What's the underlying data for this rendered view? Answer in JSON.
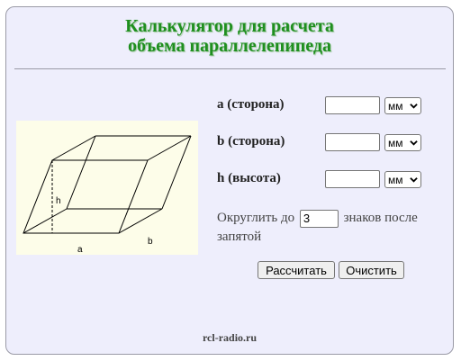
{
  "title": {
    "line1": "Калькулятор для расчета",
    "line2": "объема параллелепипеда"
  },
  "figure": {
    "label_h": "h",
    "label_a": "a",
    "label_b": "b"
  },
  "fields": [
    {
      "label": "a (сторона)",
      "value": "",
      "unit": "мм"
    },
    {
      "label": "b (сторона)",
      "value": "",
      "unit": "мм"
    },
    {
      "label": "h (высота)",
      "value": "",
      "unit": "мм"
    }
  ],
  "rounding": {
    "prefix": "Округлить до",
    "value": "3",
    "suffix": "знаков после запятой"
  },
  "buttons": {
    "calculate": "Рассчитать",
    "clear": "Очистить"
  },
  "footer": "rcl-radio.ru"
}
